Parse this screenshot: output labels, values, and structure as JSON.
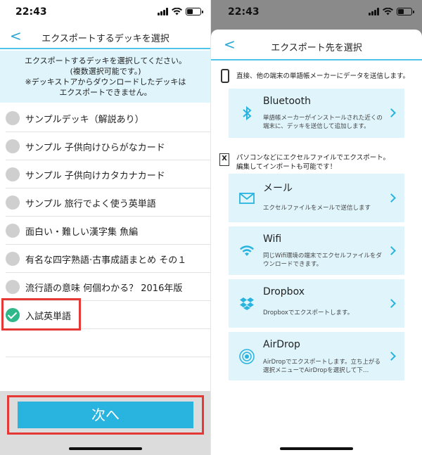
{
  "left": {
    "status": {
      "time": "22:43"
    },
    "nav": {
      "back": "<",
      "title": "エクスポートするデッキを選択"
    },
    "instructions": [
      "エクスポートするデッキを選択してください。",
      "(複数選択可能です。)",
      "※デッキストアからダウンロードしたデッキは",
      "エクスポートできません。"
    ],
    "decks": [
      {
        "label": "サンプルデッキ（解説あり）",
        "selected": false
      },
      {
        "label": "サンプル 子供向けひらがなカード",
        "selected": false
      },
      {
        "label": "サンプル 子供向けカタカナカード",
        "selected": false
      },
      {
        "label": "サンプル 旅行でよく使う英単語",
        "selected": false
      },
      {
        "label": "面白い・難しい漢字集 魚編",
        "selected": false
      },
      {
        "label": "有名な四字熟語·古事成語まとめ その１",
        "selected": false
      },
      {
        "label": "流行語の意味 何個わかる？ 2016年版",
        "selected": false
      },
      {
        "label": "入試英単語",
        "selected": true
      }
    ],
    "next_button": "次へ"
  },
  "right": {
    "status": {
      "time": "22:43"
    },
    "nav": {
      "back": "<",
      "title": "エクスポート先を選択"
    },
    "section1": {
      "icon": "phone-icon",
      "text": "直接、他の端末の単語帳メーカーにデータを送信します。"
    },
    "bluetooth": {
      "title": "Bluetooth",
      "desc": "単語帳メーカーがインストールされた近くの端末に、デッキを送信して追加します。",
      "icon": "bluetooth-icon"
    },
    "section2": {
      "icon": "excel-file-icon",
      "line1": "パソコンなどにエクセルファイルでエクスポート。",
      "line2": "編集してインポートも可能です！"
    },
    "options": [
      {
        "title": "メール",
        "desc": "エクセルファイルをメールで送信します",
        "icon": "mail-icon"
      },
      {
        "title": "Wifi",
        "desc": "同じWifi環境の端末でエクセルファイルをダウンロードできます。",
        "icon": "wifi-icon"
      },
      {
        "title": "Dropbox",
        "desc": "Dropboxでエクスポートします。",
        "icon": "dropbox-icon"
      },
      {
        "title": "AirDrop",
        "desc": "AirDropでエクスポートします。立ち上がる選択メニューでAirDropを選択して下…",
        "icon": "airdrop-icon"
      }
    ]
  },
  "colors": {
    "accent": "#29b3df",
    "highlight": "#e53935",
    "selected": "#2fb98a",
    "card_bg": "#dff4fb"
  }
}
